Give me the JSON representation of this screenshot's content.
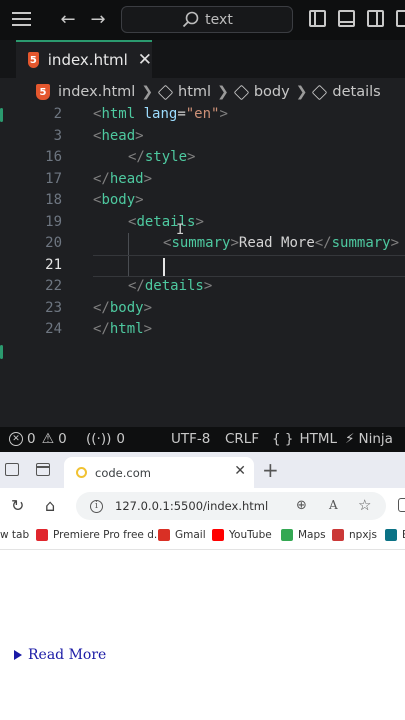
{
  "editor": {
    "command_search": {
      "text": "text"
    },
    "tab": {
      "file_name": "index.html",
      "file_icon_letter": "5"
    },
    "breadcrumb": {
      "file": "index.html",
      "items": [
        "html",
        "body",
        "details"
      ]
    },
    "lines": [
      {
        "num": "2",
        "tokens": [
          [
            "br",
            "<"
          ],
          [
            "tg",
            "html"
          ],
          [
            "sp",
            " "
          ],
          [
            "at",
            "lang"
          ],
          [
            "eq",
            "="
          ],
          [
            "st",
            "\"en\""
          ],
          [
            "br",
            ">"
          ]
        ],
        "indent": 0
      },
      {
        "num": "3",
        "tokens": [
          [
            "br",
            "<"
          ],
          [
            "tg",
            "head"
          ],
          [
            "br",
            ">"
          ]
        ],
        "indent": 0
      },
      {
        "num": "16",
        "tokens": [
          [
            "br",
            "</"
          ],
          [
            "tg",
            "style"
          ],
          [
            "br",
            ">"
          ]
        ],
        "indent": 1
      },
      {
        "num": "17",
        "tokens": [
          [
            "br",
            "</"
          ],
          [
            "tg",
            "head"
          ],
          [
            "br",
            ">"
          ]
        ],
        "indent": 0
      },
      {
        "num": "18",
        "tokens": [
          [
            "br",
            "<"
          ],
          [
            "tg",
            "body"
          ],
          [
            "br",
            ">"
          ]
        ],
        "indent": 0
      },
      {
        "num": "19",
        "tokens": [
          [
            "br",
            "<"
          ],
          [
            "tg",
            "details"
          ],
          [
            "br",
            ">"
          ]
        ],
        "indent": 1
      },
      {
        "num": "20",
        "tokens": [
          [
            "br",
            "<"
          ],
          [
            "tg",
            "summary"
          ],
          [
            "br",
            ">"
          ],
          [
            "tx",
            "Read More"
          ],
          [
            "br",
            "</"
          ],
          [
            "tg",
            "summary"
          ],
          [
            "br",
            ">"
          ]
        ],
        "indent": 2
      },
      {
        "num": "21",
        "tokens": [],
        "indent": 2,
        "active": true
      },
      {
        "num": "22",
        "tokens": [
          [
            "br",
            "</"
          ],
          [
            "tg",
            "details"
          ],
          [
            "br",
            ">"
          ]
        ],
        "indent": 1
      },
      {
        "num": "23",
        "tokens": [
          [
            "br",
            "</"
          ],
          [
            "tg",
            "body"
          ],
          [
            "br",
            ">"
          ]
        ],
        "indent": 0
      },
      {
        "num": "24",
        "tokens": [
          [
            "br",
            "</"
          ],
          [
            "tg",
            "html"
          ],
          [
            "br",
            ">"
          ]
        ],
        "indent": 0
      }
    ],
    "status": {
      "errors": "0",
      "warnings": "0",
      "ports": "0",
      "encoding": "UTF-8",
      "eol": "CRLF",
      "language": "HTML",
      "extension": "Ninja"
    }
  },
  "browser": {
    "tab_title": "code.com",
    "url": "127.0.0.1:5500/index.html",
    "bookmarks": [
      {
        "label": "w tab",
        "color": ""
      },
      {
        "label": "Premiere Pro free d...",
        "color": "#e0262d"
      },
      {
        "label": "Gmail",
        "color": "#d93025"
      },
      {
        "label": "YouTube",
        "color": "#ff0000"
      },
      {
        "label": "Maps",
        "color": "#34a853"
      },
      {
        "label": "npxjs",
        "color": "#cb3837"
      },
      {
        "label": "E",
        "color": "#0b7285"
      }
    ],
    "page": {
      "summary_text": "Read More"
    }
  },
  "colors": {
    "accent": "#2b9a6f",
    "tag": "#4ec9a0",
    "attribute": "#9cdcfe",
    "string": "#ce9178",
    "link_blue": "#1a1aa6"
  }
}
